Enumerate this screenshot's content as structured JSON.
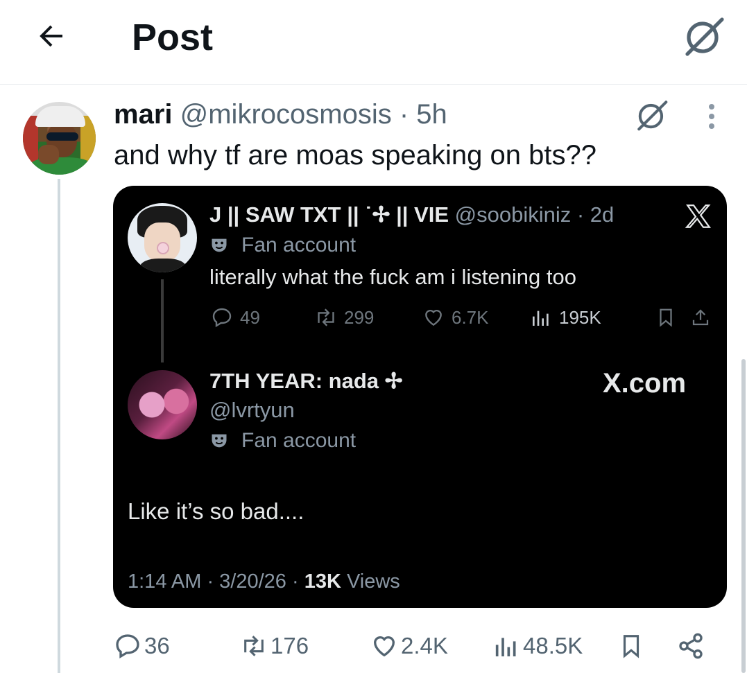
{
  "header": {
    "title": "Post",
    "back_icon": "arrow-left-icon",
    "grok_icon": "grok-icon"
  },
  "post": {
    "author_name": "mari",
    "handle": "@mikrocosmosis",
    "separator": "·",
    "time": "5h",
    "text": "and why tf are moas speaking on bts??",
    "actions": {
      "replies": "36",
      "reposts": "176",
      "likes": "2.4K",
      "views": "48.5K"
    }
  },
  "quoted_screenshot": {
    "first_post": {
      "name": "J || SAW TXT || ˙✢ || VIE",
      "handle": "@soobikiniz",
      "separator": "·",
      "time": "2d",
      "badge": "Fan account",
      "text": "literally what the fuck am i listening too",
      "replies": "49",
      "reposts": "299",
      "likes": "6.7K",
      "views": "195K"
    },
    "second_post": {
      "name": "7TH YEAR: nada ✢",
      "handle": "@lvrtyun",
      "badge": "Fan account",
      "watermark": "X.com",
      "text": "Like it’s so bad....",
      "timestamp": "1:14 AM · 3/20/26 · ",
      "views_count": "13K",
      "views_label": " Views"
    }
  },
  "colors": {
    "text_primary": "#0f1419",
    "text_secondary": "#536471",
    "card_background": "#000000",
    "divider": "#e6e9ec"
  }
}
